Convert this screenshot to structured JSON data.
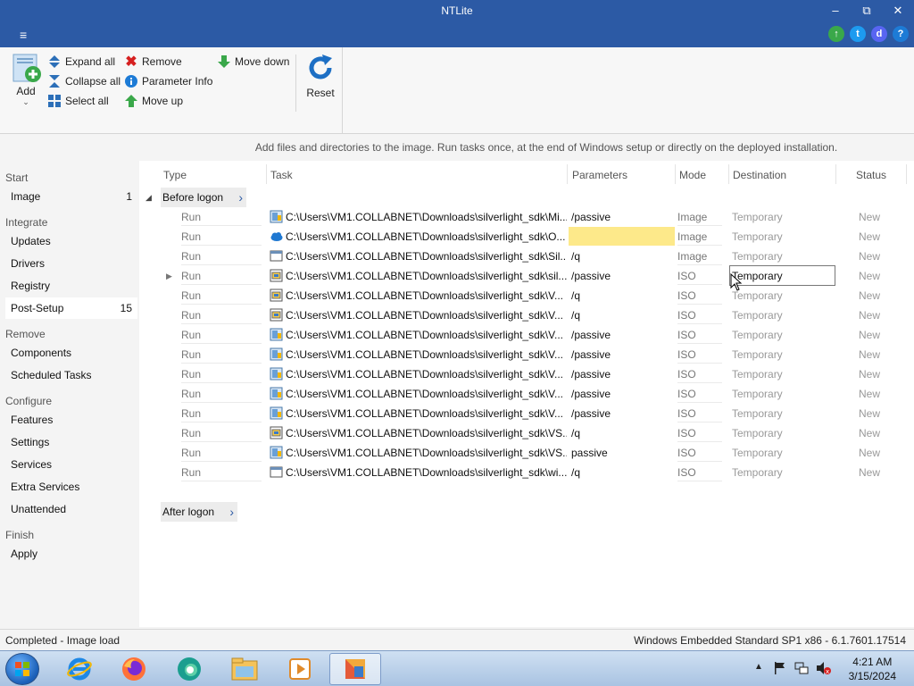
{
  "window": {
    "title": "NTLite"
  },
  "titlebar_buttons": {
    "minimize": "–",
    "restore": "⧉",
    "close": "✕"
  },
  "menu": {
    "hamburger": "≡"
  },
  "top_icons": [
    {
      "name": "update-arrow-icon",
      "color": "#3aa84a",
      "glyph": "↑"
    },
    {
      "name": "twitter-icon",
      "color": "#1d9bf0",
      "glyph": "t"
    },
    {
      "name": "discord-icon",
      "color": "#5865f2",
      "glyph": "d"
    },
    {
      "name": "help-icon",
      "color": "#1d7bd6",
      "glyph": "?"
    }
  ],
  "ribbon": {
    "add": "Add",
    "expand_all": "Expand all",
    "collapse_all": "Collapse all",
    "select_all": "Select all",
    "remove": "Remove",
    "parameter_info": "Parameter Info",
    "move_up": "Move up",
    "move_down": "Move down",
    "reset": "Reset"
  },
  "hint": "Add files and directories to the image. Run tasks once, at the end of Windows setup or directly on the deployed installation.",
  "sidebar": {
    "start": "Start",
    "image": {
      "label": "Image",
      "count": "1"
    },
    "integrate": "Integrate",
    "updates": "Updates",
    "drivers": "Drivers",
    "registry": "Registry",
    "post_setup": {
      "label": "Post-Setup",
      "count": "15"
    },
    "remove": "Remove",
    "components": "Components",
    "scheduled_tasks": "Scheduled Tasks",
    "configure": "Configure",
    "features": "Features",
    "settings": "Settings",
    "services": "Services",
    "extra_services": "Extra Services",
    "unattended": "Unattended",
    "finish": "Finish",
    "apply": "Apply"
  },
  "columns": {
    "type": "Type",
    "task": "Task",
    "parameters": "Parameters",
    "mode": "Mode",
    "destination": "Destination",
    "status": "Status"
  },
  "groups": {
    "before_logon": "Before logon",
    "after_logon": "After logon"
  },
  "rows": [
    {
      "type": "Run",
      "icon": "installer",
      "task": "C:\\Users\\VM1.COLLABNET\\Downloads\\silverlight_sdk\\Mi...",
      "params": "/passive",
      "mode": "Image",
      "dest": "Temporary",
      "status": "New"
    },
    {
      "type": "Run",
      "icon": "cloud",
      "task": "C:\\Users\\VM1.COLLABNET\\Downloads\\silverlight_sdk\\O...",
      "params": "",
      "mode": "Image",
      "dest": "Temporary",
      "status": "New"
    },
    {
      "type": "Run",
      "icon": "window",
      "task": "C:\\Users\\VM1.COLLABNET\\Downloads\\silverlight_sdk\\Sil...",
      "params": "/q",
      "mode": "Image",
      "dest": "Temporary",
      "status": "New"
    },
    {
      "type": "Run",
      "icon": "setup",
      "task": "C:\\Users\\VM1.COLLABNET\\Downloads\\silverlight_sdk\\sil...",
      "params": "/passive",
      "mode": "ISO",
      "dest": "Temporary",
      "status": "New"
    },
    {
      "type": "Run",
      "icon": "setup",
      "task": "C:\\Users\\VM1.COLLABNET\\Downloads\\silverlight_sdk\\V...",
      "params": "/q",
      "mode": "ISO",
      "dest": "Temporary",
      "status": "New"
    },
    {
      "type": "Run",
      "icon": "setup",
      "task": "C:\\Users\\VM1.COLLABNET\\Downloads\\silverlight_sdk\\V...",
      "params": "/q",
      "mode": "ISO",
      "dest": "Temporary",
      "status": "New"
    },
    {
      "type": "Run",
      "icon": "installer",
      "task": "C:\\Users\\VM1.COLLABNET\\Downloads\\silverlight_sdk\\V...",
      "params": "/passive",
      "mode": "ISO",
      "dest": "Temporary",
      "status": "New"
    },
    {
      "type": "Run",
      "icon": "installer",
      "task": "C:\\Users\\VM1.COLLABNET\\Downloads\\silverlight_sdk\\V...",
      "params": "/passive",
      "mode": "ISO",
      "dest": "Temporary",
      "status": "New"
    },
    {
      "type": "Run",
      "icon": "installer",
      "task": "C:\\Users\\VM1.COLLABNET\\Downloads\\silverlight_sdk\\V...",
      "params": "/passive",
      "mode": "ISO",
      "dest": "Temporary",
      "status": "New"
    },
    {
      "type": "Run",
      "icon": "installer",
      "task": "C:\\Users\\VM1.COLLABNET\\Downloads\\silverlight_sdk\\V...",
      "params": "/passive",
      "mode": "ISO",
      "dest": "Temporary",
      "status": "New"
    },
    {
      "type": "Run",
      "icon": "installer",
      "task": "C:\\Users\\VM1.COLLABNET\\Downloads\\silverlight_sdk\\V...",
      "params": "/passive",
      "mode": "ISO",
      "dest": "Temporary",
      "status": "New"
    },
    {
      "type": "Run",
      "icon": "setup",
      "task": "C:\\Users\\VM1.COLLABNET\\Downloads\\silverlight_sdk\\VS...",
      "params": "/q",
      "mode": "ISO",
      "dest": "Temporary",
      "status": "New"
    },
    {
      "type": "Run",
      "icon": "installer",
      "task": "C:\\Users\\VM1.COLLABNET\\Downloads\\silverlight_sdk\\VS...",
      "params": "passive",
      "mode": "ISO",
      "dest": "Temporary",
      "status": "New"
    },
    {
      "type": "Run",
      "icon": "window",
      "task": "C:\\Users\\VM1.COLLABNET\\Downloads\\silverlight_sdk\\wi...",
      "params": "/q",
      "mode": "ISO",
      "dest": "Temporary",
      "status": "New"
    }
  ],
  "statusbar": {
    "left": "Completed - Image load",
    "right": "Windows Embedded Standard SP1 x86 - 6.1.7601.17514"
  },
  "taskbar": {
    "apps": [
      "internet-explorer",
      "firefox",
      "edge",
      "file-explorer",
      "media-player",
      "ntlite"
    ],
    "time": "4:21 AM",
    "date": "3/15/2024"
  },
  "colors": {
    "accent": "#2c5aa5",
    "highlight": "#fde98a"
  }
}
